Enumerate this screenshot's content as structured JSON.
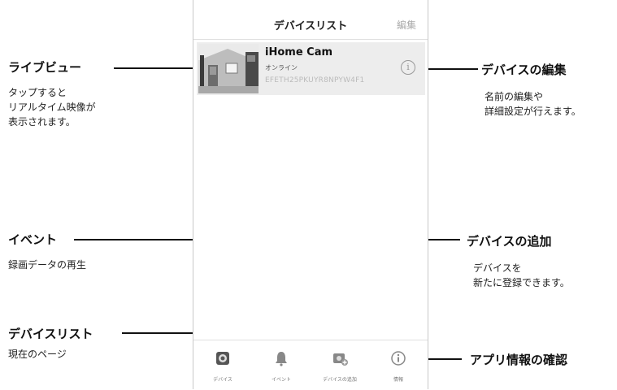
{
  "screen": {
    "title": "デバイスリスト",
    "edit_label": "編集"
  },
  "device": {
    "name": "iHome Cam",
    "status": "オンライン",
    "id": "EFETH25PKUYR8NPYW4F1",
    "info_glyph": "i"
  },
  "tabs": [
    {
      "label": "デバイス",
      "icon": "device-camera-icon"
    },
    {
      "label": "イベント",
      "icon": "bell-icon"
    },
    {
      "label": "デバイスの追加",
      "icon": "add-device-icon"
    },
    {
      "label": "情報",
      "icon": "info-icon"
    }
  ],
  "annotations": {
    "live_view": {
      "title": "ライブビュー",
      "lines": [
        "タップすると",
        "リアルタイム映像が",
        "表示されます。"
      ]
    },
    "edit_device": {
      "title": "デバイスの編集",
      "lines": [
        "名前の編集や",
        "詳細設定が行えます。"
      ]
    },
    "event": {
      "title": "イベント",
      "lines": [
        "録画データの再生"
      ]
    },
    "add_device": {
      "title": "デバイスの追加",
      "lines": [
        "デバイスを",
        "新たに登録できます。"
      ]
    },
    "device_list": {
      "title": "デバイスリスト",
      "lines": [
        "現在のページ"
      ]
    },
    "app_info": {
      "title": "アプリ情報の確認"
    }
  },
  "colors": {
    "row_background": "#ededed",
    "border": "#c9c9c9",
    "muted_text": "#aaaaaa"
  }
}
